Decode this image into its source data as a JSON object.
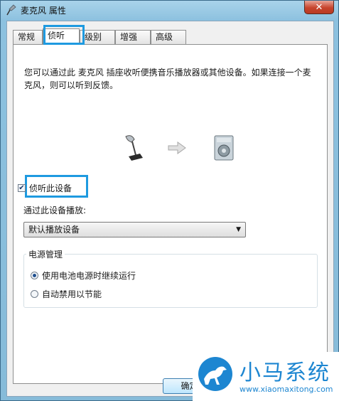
{
  "window": {
    "title": "麦克风 属性",
    "close_label": "✕"
  },
  "tabs": [
    "常规",
    "侦听",
    "级别",
    "增强",
    "高级"
  ],
  "active_tab": "侦听",
  "description": "您可以通过此 麦克风 插座收听便携音乐播放器或其他设备。如果连接一个麦克风，则可以听到反馈。",
  "listen_checkbox": {
    "label": "侦听此设备",
    "checked": true
  },
  "playback": {
    "label": "通过此设备播放:",
    "selected": "默认播放设备"
  },
  "power": {
    "label": "电源管理",
    "options": [
      {
        "label": "使用电池电源时继续运行",
        "selected": true
      },
      {
        "label": "自动禁用以节能",
        "selected": false
      }
    ]
  },
  "buttons": {
    "ok": "确定"
  },
  "watermark": {
    "brand": "小马系统",
    "url": "www.xiaomaxitong.com"
  },
  "colors": {
    "highlight": "#1e9ae0",
    "brand": "#1d86d1"
  }
}
